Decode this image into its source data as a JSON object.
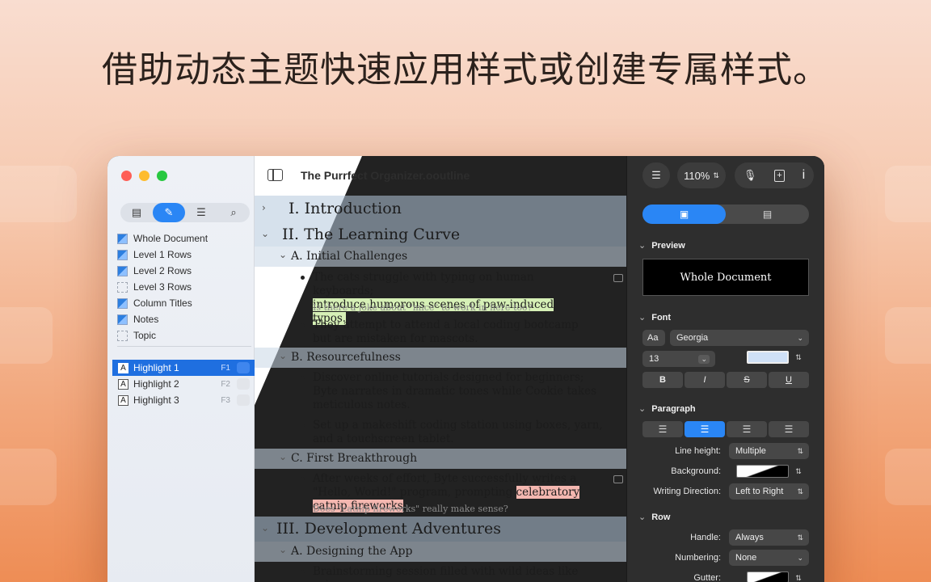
{
  "headline": "借助动态主题快速应用样式或创建专属样式。",
  "window": {
    "title": "The Purrfect Organizer.ooutline"
  },
  "sidebar": {
    "tabs": [
      {
        "icon": "document-icon",
        "glyph": "▤"
      },
      {
        "icon": "brush-icon",
        "glyph": "✎"
      },
      {
        "icon": "filter-icon",
        "glyph": "☰"
      },
      {
        "icon": "search-icon",
        "glyph": "⌕"
      }
    ],
    "styles": [
      {
        "label": "Whole Document"
      },
      {
        "label": "Level 1 Rows"
      },
      {
        "label": "Level 2 Rows"
      },
      {
        "label": "Level 3 Rows"
      },
      {
        "label": "Column Titles"
      },
      {
        "label": "Notes"
      },
      {
        "label": "Topic"
      }
    ],
    "highlights": [
      {
        "label": "Highlight 1",
        "key": "F1"
      },
      {
        "label": "Highlight 2",
        "key": "F2"
      },
      {
        "label": "Highlight 3",
        "key": "F3"
      }
    ]
  },
  "outline": {
    "r1": "I.  Introduction",
    "r2": "II.  The Learning Curve",
    "r2a": "A.  Initial Challenges",
    "p1a": "The cats struggle with typing on human keyboards;",
    "p1b": "introduce humorous scenes of paw-induced typos.",
    "n1": "Is there a joke about \"mice\" to work in here too?",
    "p2": "They attempt to attend a local coding bootcamp but are mistaken for mascots.",
    "r2b": "B.  Resourcefulness",
    "p3": "Discover online tutorials designed for beginners; Byte narrates in dramatic tones while Cookie takes meticulous notes.",
    "p4": "Set up a makeshift coding station using boxes, yarn, and a touchscreen tablet.",
    "r2c": "C.  First Breakthrough",
    "p5a": "After weeks of effort, Byte successfully writes a \"Hello, World!\" program, prompting",
    "p5b": "celebratory catnip fireworks",
    "p5c": ".",
    "n2": "Does  \"catnip fireworks\" really make sense?",
    "r3": "III.  Development Adventures",
    "r3a": "A.  Designing the App",
    "p6": "Brainstorming session filled with wild ideas like voice-"
  },
  "inspector": {
    "zoom": "110%",
    "preview_label": "Preview",
    "preview_text": "Whole Document",
    "font_label": "Font",
    "font_family": "Georgia",
    "font_size": "13",
    "aa": "Aa",
    "bold": "B",
    "italic": "I",
    "strike": "S",
    "underline": "U",
    "paragraph_label": "Paragraph",
    "line_height_label": "Line height:",
    "line_height": "Multiple",
    "background_label": "Background:",
    "writing_direction_label": "Writing Direction:",
    "writing_direction": "Left to Right",
    "row_label": "Row",
    "handle_label": "Handle:",
    "handle": "Always",
    "numbering_label": "Numbering:",
    "numbering": "None",
    "gutter_label": "Gutter:"
  }
}
